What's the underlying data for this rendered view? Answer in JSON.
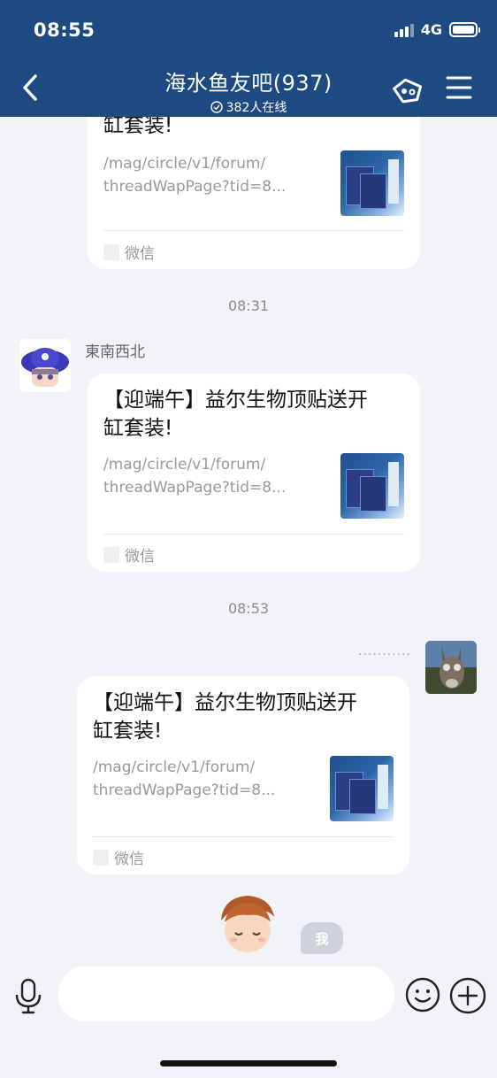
{
  "status_bar": {
    "time": "08:55",
    "network": "4G"
  },
  "header": {
    "title": "海水鱼友吧(937)",
    "online": "382人在线"
  },
  "messages": [
    {
      "title_tail": "缸套装!",
      "url_line1": "/mag/circle/v1/forum/",
      "url_line2": "threadWapPage?tid=8...",
      "source": "微信"
    },
    {
      "timeline": "08:31"
    },
    {
      "sender": "東南西北",
      "title_line1": "【迎端午】益尔生物顶贴送开",
      "title_line2": "缸套装!",
      "url_line1": "/mag/circle/v1/forum/",
      "url_line2": "threadWapPage?tid=8...",
      "source": "微信"
    },
    {
      "timeline": "08:53"
    },
    {
      "sender_dots": "...........",
      "title_line1": "【迎端午】益尔生物顶贴送开",
      "title_line2": "缸套装!",
      "url_line1": "/mag/circle/v1/forum/",
      "url_line2": "threadWapPage?tid=8...",
      "source": "微信"
    }
  ],
  "me_tag": "我"
}
